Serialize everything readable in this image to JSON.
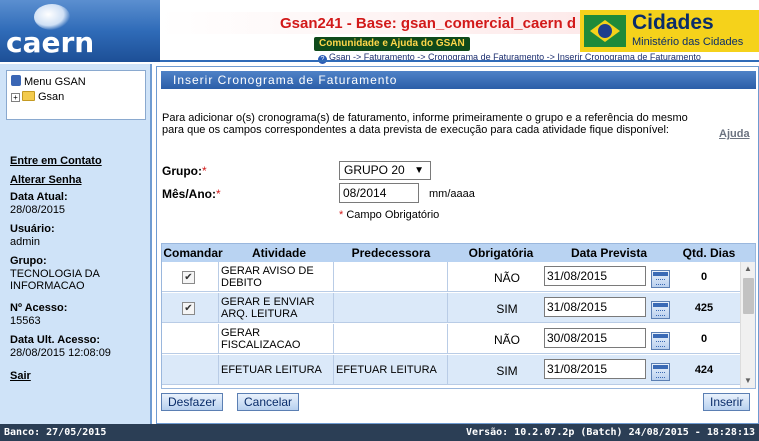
{
  "header": {
    "logo_text": "caern",
    "app_title": "Gsan241 - Base: gsan_comercial_caern d",
    "community_label": "Comunidade e Ajuda do GSAN",
    "breadcrumb": "Gsan -> Faturamento -> Cronograma de Faturamento -> Inserir Cronograma de Faturamento",
    "ministry_title": "Cidades",
    "ministry_subtitle": "Ministério das Cidades"
  },
  "sidebar": {
    "menu_label": "Menu GSAN",
    "tree_root": "Gsan",
    "contact_link": "Entre em Contato",
    "change_password_link": "Alterar Senha",
    "date_label": "Data Atual:",
    "date_value": "28/08/2015",
    "user_label": "Usuário:",
    "user_value": "admin",
    "group_label": "Grupo:",
    "group_value": "TECNOLOGIA DA INFORMACAO",
    "access_label": "Nº Acesso:",
    "access_value": "15563",
    "last_access_label": "Data Ult. Acesso:",
    "last_access_value": "28/08/2015 12:08:09",
    "logout_link": "Sair"
  },
  "form": {
    "title": "Inserir Cronograma de Faturamento",
    "instructions": "Para adicionar o(s) cronograma(s) de faturamento, informe primeiramente o grupo e a referência do mesmo para que os campos correspondentes a data prevista de execução para cada atividade fique disponível:",
    "help_link": "Ajuda",
    "group_label": "Grupo:",
    "group_selected": "GRUPO 20",
    "month_year_label": "Mês/Ano:",
    "month_year_value": "08/2014",
    "month_year_format": "mm/aaaa",
    "required_note": "Campo Obrigatório",
    "required_mark": "*"
  },
  "table": {
    "headers": {
      "comandar": "Comandar",
      "atividade": "Atividade",
      "predecessora": "Predecessora",
      "obrigatoria": "Obrigatória",
      "data_prevista": "Data Prevista",
      "qtd_dias": "Qtd. Dias"
    },
    "rows": [
      {
        "checked": true,
        "atividade": "GERAR AVISO DE DEBITO",
        "predecessora": "",
        "obrigatoria": "NÃO",
        "data_prevista": "31/08/2015",
        "qtd_dias": "0"
      },
      {
        "checked": true,
        "atividade": "GERAR E ENVIAR ARQ. LEITURA",
        "predecessora": "",
        "obrigatoria": "SIM",
        "data_prevista": "31/08/2015",
        "qtd_dias": "425"
      },
      {
        "checked": false,
        "atividade": "GERAR FISCALIZACAO",
        "predecessora": "",
        "obrigatoria": "NÃO",
        "data_prevista": "30/08/2015",
        "qtd_dias": "0"
      },
      {
        "checked": false,
        "atividade": "EFETUAR LEITURA",
        "predecessora": "EFETUAR LEITURA",
        "obrigatoria": "SIM",
        "data_prevista": "31/08/2015",
        "qtd_dias": "424"
      }
    ]
  },
  "buttons": {
    "undo": "Desfazer",
    "cancel": "Cancelar",
    "insert": "Inserir"
  },
  "status_bar": {
    "left": "Banco: 27/05/2015",
    "right": "Versão: 10.2.07.2p (Batch) 24/08/2015 - 18:28:13"
  },
  "icons": {
    "menu": "menu-icon",
    "folder": "folder-icon",
    "calendar": "calendar-icon",
    "check": "✔",
    "help": "?",
    "expand": "+"
  },
  "colors": {
    "title_red": "#d21a1a",
    "panel_blue": "#2b5ea8",
    "sidebar_bg": "#cfe3f8",
    "status_bg": "#2b3e55"
  }
}
